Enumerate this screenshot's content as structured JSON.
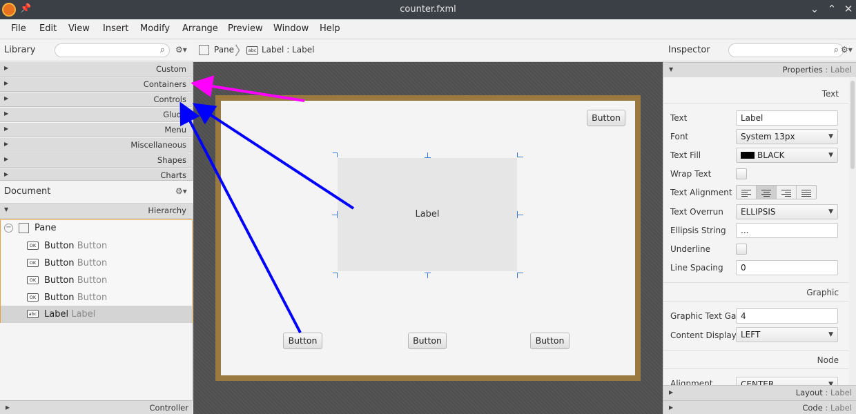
{
  "window": {
    "title": "counter.fxml"
  },
  "menu": [
    "File",
    "Edit",
    "View",
    "Insert",
    "Modify",
    "Arrange",
    "Preview",
    "Window",
    "Help"
  ],
  "library": {
    "title": "Library",
    "categories": [
      "Custom",
      "Containers",
      "Controls",
      "Gluon",
      "Menu",
      "Miscellaneous",
      "Shapes",
      "Charts"
    ]
  },
  "document": {
    "title": "Document",
    "hierarchy_label": "Hierarchy",
    "root": "Pane",
    "items": [
      {
        "icon": "OK",
        "name": "Button",
        "type": "Button"
      },
      {
        "icon": "OK",
        "name": "Button",
        "type": "Button"
      },
      {
        "icon": "OK",
        "name": "Button",
        "type": "Button"
      },
      {
        "icon": "OK",
        "name": "Button",
        "type": "Button"
      },
      {
        "icon": "abc",
        "name": "Label",
        "type": "Label"
      }
    ],
    "controller": "Controller"
  },
  "breadcrumb": {
    "root": "Pane",
    "icon": "abc",
    "current": "Label : Label"
  },
  "canvas": {
    "button": "Button",
    "label": "Label"
  },
  "inspector": {
    "title": "Inspector",
    "properties": "Properties",
    "properties_target": ": Label",
    "text_section": "Text",
    "text_label": "Text",
    "text_value": "Label",
    "font_label": "Font",
    "font_value": "System 13px",
    "fill_label": "Text Fill",
    "fill_value": "BLACK",
    "wrap_label": "Wrap Text",
    "align_label": "Text Alignment",
    "overrun_label": "Text Overrun",
    "overrun_value": "ELLIPSIS",
    "ellipsis_label": "Ellipsis String",
    "ellipsis_value": "...",
    "underline_label": "Underline",
    "spacing_label": "Line Spacing",
    "spacing_value": "0",
    "graphic_section": "Graphic",
    "gap_label": "Graphic Text Gap",
    "gap_value": "4",
    "display_label": "Content Display",
    "display_value": "LEFT",
    "node_section": "Node",
    "alignment_label": "Alignment",
    "alignment_value": "CENTER",
    "layout": "Layout",
    "code": "Code",
    "target": ": Label"
  },
  "colors": {
    "accent": "#3d7fd6",
    "selection_border": "#e5a23a",
    "frame": "#9a7a40",
    "arrow_magenta": "#ff00ff",
    "arrow_blue": "#0000ff"
  }
}
